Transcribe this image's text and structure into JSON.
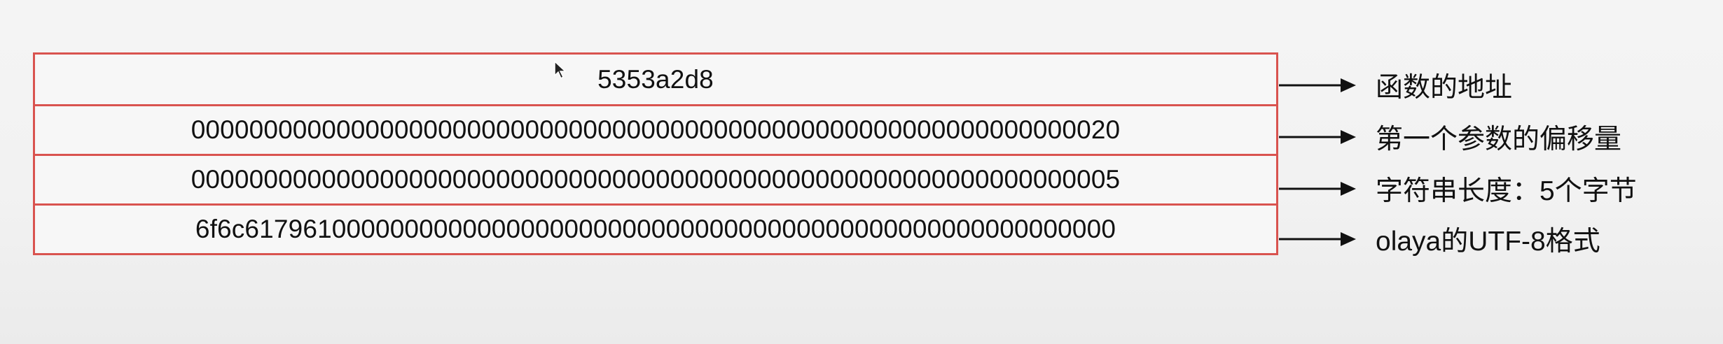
{
  "rows": [
    {
      "value": "5353a2d8",
      "note": "函数的地址"
    },
    {
      "value": "0000000000000000000000000000000000000000000000000000000000000020",
      "note": "第一个参数的偏移量"
    },
    {
      "value": "0000000000000000000000000000000000000000000000000000000000000005",
      "note": "字符串长度：5个字节"
    },
    {
      "value": "6f6c617961000000000000000000000000000000000000000000000000000000",
      "note": "olaya的UTF-8格式"
    }
  ],
  "colors": {
    "cell_border": "#d9534f",
    "arrow": "#111111"
  }
}
